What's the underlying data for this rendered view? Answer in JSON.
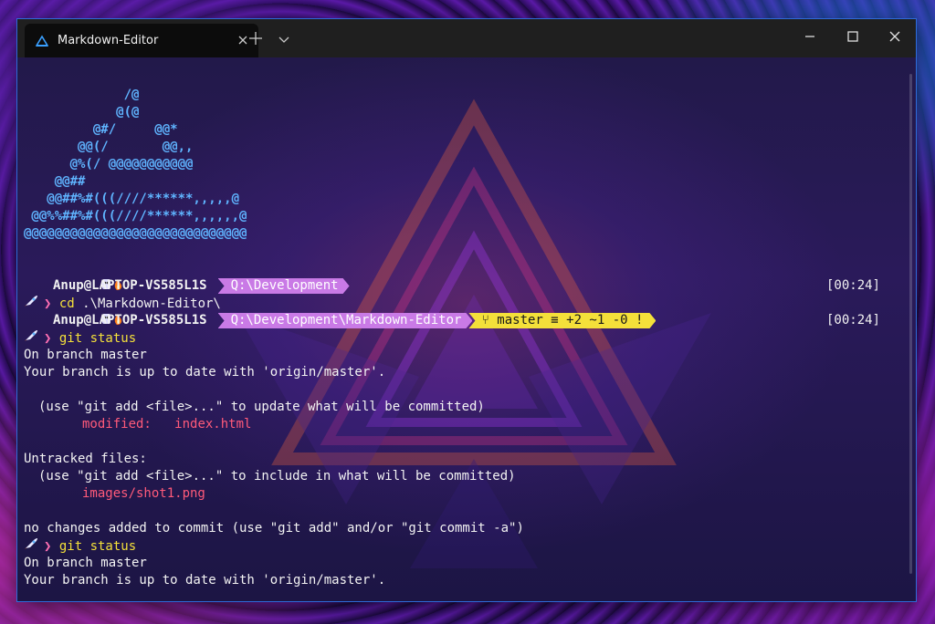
{
  "window": {
    "tab_title": "Markdown-Editor"
  },
  "colors": {
    "accent": "#2e6bd8",
    "path_segment": "#c97ae6",
    "git_segment": "#f4e03a",
    "modified_text": "#ff5a7a",
    "ascii_art": "#5fb4ff"
  },
  "icons": {
    "tab": "terminal-icon",
    "close": "close-icon",
    "new_tab": "plus-icon",
    "dropdown": "chevron-down-icon",
    "minimize": "minimize-icon",
    "maximize": "maximize-icon",
    "window_close": "close-icon"
  },
  "ascii_art": [
    "             /@",
    "            @(@",
    "         @#/     @@*",
    "       @@(/       @@,,",
    "      @%(/ @@@@@@@@@@@",
    "    @@##",
    "   @@##%#(((////******,,,,,@",
    " @@%%##%#(((////******,,,,,,@",
    "@@@@@@@@@@@@@@@@@@@@@@@@@@@@@"
  ],
  "prompts": [
    {
      "user": "Anup@LAPTOP-VS585L1S",
      "path": "Q:\\Development",
      "git": "",
      "time": "[00:24]"
    },
    {
      "user": "Anup@LAPTOP-VS585L1S",
      "path": "Q:\\Development\\Markdown-Editor",
      "git": " master ≡ +2 ~1 -0 !",
      "time": "[00:24]"
    }
  ],
  "commands": {
    "cd_cmd": "cd",
    "cd_args": " .\\Markdown-Editor\\",
    "git1": "git status",
    "git2": "git status"
  },
  "output1": {
    "branch": "On branch master",
    "uptodate": "Your branch is up to date with 'origin/master'.",
    "hint_add": "(use \"git add <file>...\" to update what will be committed)",
    "modified_label": "modified:",
    "modified_file": "index.html",
    "untracked": "Untracked files:",
    "hint_untracked": "(use \"git add <file>...\" to include in what will be committed)",
    "untracked_file": "images/shot1.png",
    "no_changes": "no changes added to commit (use \"git add\" and/or \"git commit -a\")"
  },
  "output2": {
    "branch": "On branch master",
    "uptodate": "Your branch is up to date with 'origin/master'."
  }
}
